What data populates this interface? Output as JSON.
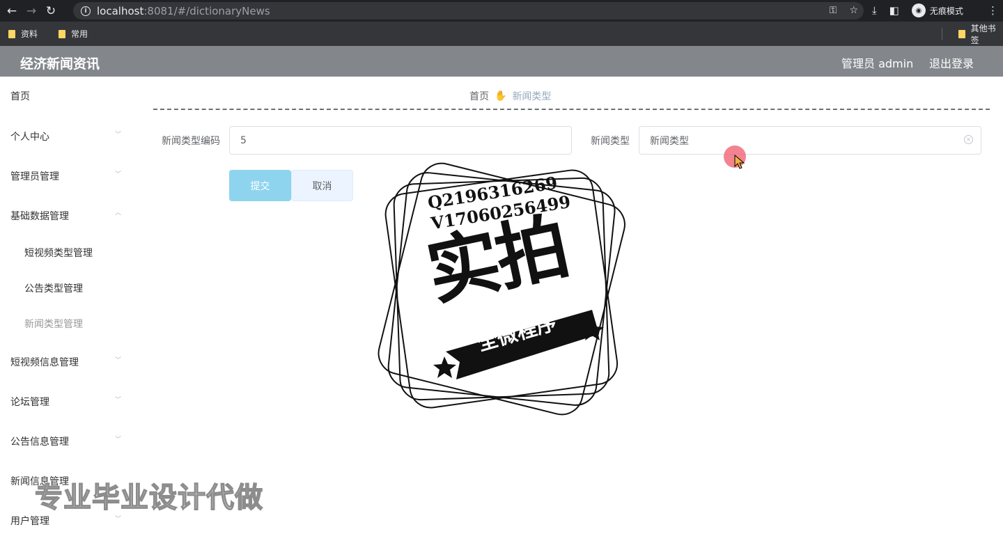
{
  "browser": {
    "url_host": "localhost",
    "url_rest": ":8081/#/dictionaryNews",
    "incognito_label": "无痕模式",
    "bookmarks": [
      "资料",
      "常用"
    ],
    "other_bookmarks": "其他书签"
  },
  "header": {
    "title": "经济新闻资讯",
    "admin": "管理员 admin",
    "logout": "退出登录"
  },
  "sidebar": {
    "items": [
      {
        "label": "首页"
      },
      {
        "label": "个人中心"
      },
      {
        "label": "管理员管理"
      },
      {
        "label": "基础数据管理"
      },
      {
        "label": "短视频类型管理"
      },
      {
        "label": "公告类型管理"
      },
      {
        "label": "新闻类型管理"
      },
      {
        "label": "短视频信息管理"
      },
      {
        "label": "论坛管理"
      },
      {
        "label": "公告信息管理"
      },
      {
        "label": "新闻信息管理"
      },
      {
        "label": "用户管理"
      }
    ]
  },
  "breadcrumb": {
    "home": "首页",
    "current": "新闻类型"
  },
  "form": {
    "code_label": "新闻类型编码",
    "code_value": "5",
    "type_label": "新闻类型",
    "type_value": "新闻类型",
    "submit": "提交",
    "cancel": "取消"
  },
  "watermark": {
    "qq": "Q2196316269",
    "vx": "V17060256499",
    "big": "实拍",
    "ribbon": "全微程序",
    "bottom": "专业毕业设计代做"
  },
  "colors": {
    "header_bg": "#83878c",
    "submit_bg": "#8fd4ee",
    "cancel_bg": "#ecf5ff"
  }
}
